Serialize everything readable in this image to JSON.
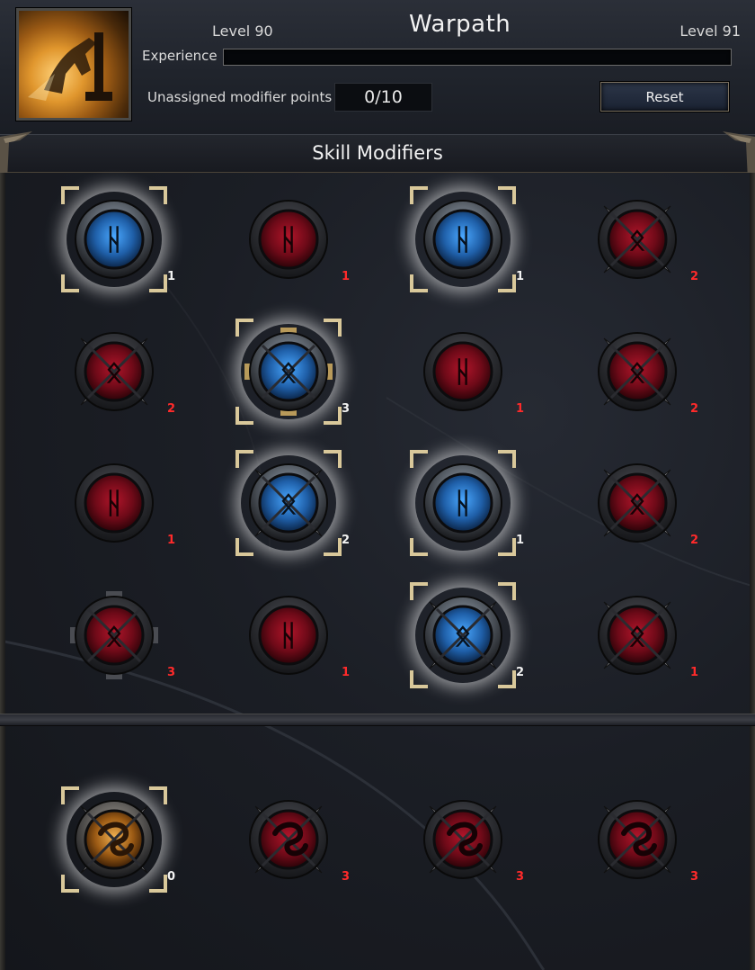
{
  "header": {
    "skill_name": "Warpath",
    "level_current": "Level 90",
    "level_next": "Level 91",
    "experience_label": "Experience",
    "experience_progress": 0.0,
    "unassigned_label": "Unassigned modifier points",
    "unassigned_value": "0/10",
    "reset_label": "Reset"
  },
  "section": {
    "title": "Skill Modifiers"
  },
  "colors": {
    "active_gem": "#4aa8ff",
    "inactive_gem": "#b1152a",
    "gold_gem": "#f0b050",
    "active_count": "#f2f2f2",
    "inactive_count": "#ff2a2a",
    "frame": "#d9c89a"
  },
  "grid": [
    [
      {
        "glyph": "ᚺ",
        "state": "active",
        "shape": "round",
        "count": "1"
      },
      {
        "glyph": "ᚺ",
        "state": "inactive",
        "shape": "round",
        "count": "1"
      },
      {
        "glyph": "ᚺ",
        "state": "active",
        "shape": "round",
        "count": "1"
      },
      {
        "glyph": "ᛟ",
        "state": "inactive",
        "shape": "spiked",
        "count": "2"
      }
    ],
    [
      {
        "glyph": "ᛟ",
        "state": "inactive",
        "shape": "spiked",
        "count": "2"
      },
      {
        "glyph": "ᛟ",
        "state": "active",
        "shape": "crossed",
        "count": "3"
      },
      {
        "glyph": "ᚺ",
        "state": "inactive",
        "shape": "round",
        "count": "1"
      },
      {
        "glyph": "ᛟ",
        "state": "inactive",
        "shape": "spiked",
        "count": "2"
      }
    ],
    [
      {
        "glyph": "ᚺ",
        "state": "inactive",
        "shape": "round",
        "count": "1"
      },
      {
        "glyph": "ᛟ",
        "state": "active",
        "shape": "spiked",
        "count": "2"
      },
      {
        "glyph": "ᚺ",
        "state": "active",
        "shape": "round",
        "count": "1"
      },
      {
        "glyph": "ᛟ",
        "state": "inactive",
        "shape": "spiked",
        "count": "2"
      }
    ],
    [
      {
        "glyph": "ᛟ",
        "state": "inactive",
        "shape": "crossed",
        "count": "3"
      },
      {
        "glyph": "ᚺ",
        "state": "inactive",
        "shape": "round",
        "count": "1"
      },
      {
        "glyph": "ᛟ",
        "state": "active",
        "shape": "spiked",
        "count": "2"
      },
      {
        "glyph": "ᛟ",
        "state": "inactive",
        "shape": "spiked",
        "count": "1"
      }
    ]
  ],
  "bottom_row": [
    {
      "glyph": "",
      "state": "gold",
      "shape": "spiked",
      "count": "0"
    },
    {
      "glyph": "",
      "state": "inactive",
      "shape": "spiked",
      "count": "3"
    },
    {
      "glyph": "",
      "state": "inactive",
      "shape": "spiked",
      "count": "3"
    },
    {
      "glyph": "",
      "state": "inactive",
      "shape": "spiked",
      "count": "3"
    }
  ]
}
